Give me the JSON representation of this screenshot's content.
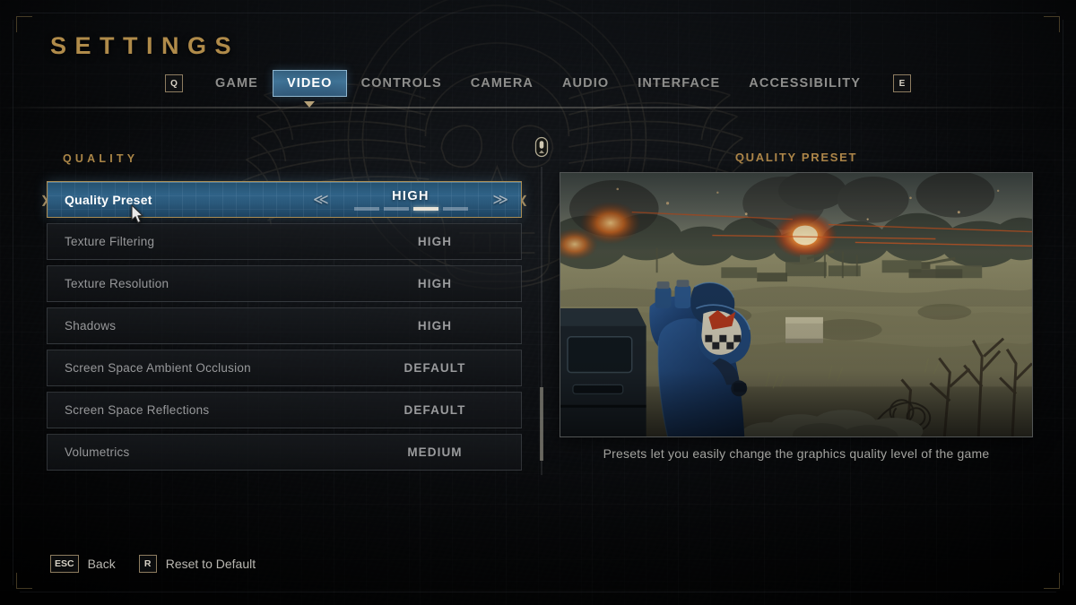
{
  "header": {
    "title": "SETTINGS",
    "prev_tab_key": "Q",
    "next_tab_key": "E"
  },
  "tabs": [
    {
      "label": "GAME",
      "active": false
    },
    {
      "label": "VIDEO",
      "active": true
    },
    {
      "label": "CONTROLS",
      "active": false
    },
    {
      "label": "CAMERA",
      "active": false
    },
    {
      "label": "AUDIO",
      "active": false
    },
    {
      "label": "INTERFACE",
      "active": false
    },
    {
      "label": "ACCESSIBILITY",
      "active": false
    }
  ],
  "section": {
    "label": "QUALITY"
  },
  "settings": [
    {
      "name": "Quality Preset",
      "value": "HIGH",
      "selected": true
    },
    {
      "name": "Texture Filtering",
      "value": "HIGH",
      "selected": false
    },
    {
      "name": "Texture Resolution",
      "value": "HIGH",
      "selected": false
    },
    {
      "name": "Shadows",
      "value": "HIGH",
      "selected": false
    },
    {
      "name": "Screen Space Ambient Occlusion",
      "value": "DEFAULT",
      "selected": false
    },
    {
      "name": "Screen Space Reflections",
      "value": "DEFAULT",
      "selected": false
    },
    {
      "name": "Volumetrics",
      "value": "MEDIUM",
      "selected": false
    }
  ],
  "stepper": {
    "left_arrow": "≪",
    "right_arrow": "≫",
    "value": "HIGH",
    "segment_count": 4,
    "segment_active_index": 2
  },
  "preview": {
    "title": "QUALITY PRESET",
    "description": "Presets let you easily change the graphics quality level of the game",
    "image_alt": "Space Marine in trench overlooking a war-torn battlefield"
  },
  "scroll": {
    "icon": "mouse-wheel-icon"
  },
  "footer": [
    {
      "key": "ESC",
      "label": "Back"
    },
    {
      "key": "R",
      "label": "Reset to Default"
    }
  ],
  "colors": {
    "accent_gold": "#b08b4a",
    "selected_blue": "#2f6287",
    "selected_border": "#a98c53",
    "text_primary": "#cfcfcf",
    "text_muted": "#97989a"
  }
}
